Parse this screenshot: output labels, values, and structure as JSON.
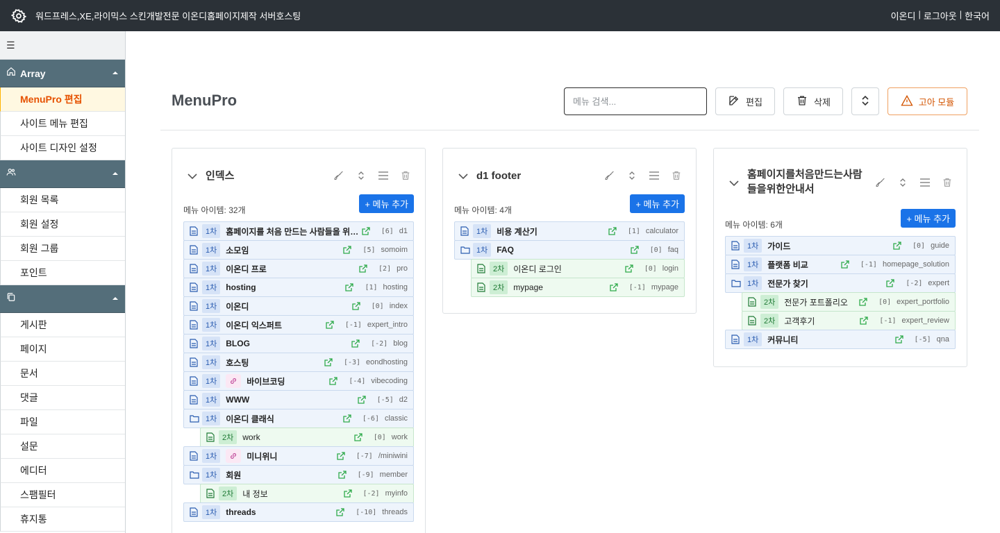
{
  "topbar": {
    "title": "워드프레스,XE,라이믹스 스킨개발전문 이온디홈페이지제작 서버호스팅",
    "user": "이온디",
    "logout": "로그아웃",
    "lang": "한국어",
    "sep": "|"
  },
  "sidebar": {
    "hamburger": "☰",
    "group1": {
      "title": "Array"
    },
    "items1": [
      "MenuPro 편집",
      "사이트 메뉴 편집",
      "사이트 디자인 설정"
    ],
    "items2": [
      "회원 목록",
      "회원 설정",
      "회원 그룹",
      "포인트"
    ],
    "items3": [
      "게시판",
      "페이지",
      "문서",
      "댓글",
      "파일",
      "설문",
      "에디터",
      "스팸필터",
      "휴지통"
    ]
  },
  "header": {
    "title": "MenuPro",
    "search_placeholder": "메뉴 검색...",
    "edit": "편집",
    "delete": "삭제",
    "orphan": "고아 모듈"
  },
  "panels": [
    {
      "title": "인덱스",
      "count": "메뉴 아이템: 32개",
      "add": "+ 메뉴 추가",
      "rows": [
        {
          "lvl": "1차",
          "name": "홈페이지를 처음 만드는 사람들을 위한…",
          "idx": "[6]",
          "slug": "d1",
          "child": false,
          "link": false
        },
        {
          "lvl": "1차",
          "name": "소모임",
          "idx": "[5]",
          "slug": "somoim",
          "child": false,
          "link": false
        },
        {
          "lvl": "1차",
          "name": "이온디 프로",
          "idx": "[2]",
          "slug": "pro",
          "child": false,
          "link": false
        },
        {
          "lvl": "1차",
          "name": "hosting",
          "idx": "[1]",
          "slug": "hosting",
          "child": false,
          "link": false
        },
        {
          "lvl": "1차",
          "name": "이온디",
          "idx": "[0]",
          "slug": "index",
          "child": false,
          "link": false
        },
        {
          "lvl": "1차",
          "name": "이온디 익스퍼트",
          "idx": "[-1]",
          "slug": "expert_intro",
          "child": false,
          "link": false
        },
        {
          "lvl": "1차",
          "name": "BLOG",
          "idx": "[-2]",
          "slug": "blog",
          "child": false,
          "link": false
        },
        {
          "lvl": "1차",
          "name": "호스팅",
          "idx": "[-3]",
          "slug": "eondhosting",
          "child": false,
          "link": false
        },
        {
          "lvl": "1차",
          "name": "바이브코딩",
          "idx": "[-4]",
          "slug": "vibecoding",
          "child": false,
          "link": true
        },
        {
          "lvl": "1차",
          "name": "WWW",
          "idx": "[-5]",
          "slug": "d2",
          "child": false,
          "link": false
        },
        {
          "lvl": "1차",
          "name": "이온디 클래식",
          "idx": "[-6]",
          "slug": "classic",
          "child": false,
          "link": false,
          "folder": true
        },
        {
          "lvl": "2차",
          "name": "work",
          "idx": "[0]",
          "slug": "work",
          "child": true,
          "link": false
        },
        {
          "lvl": "1차",
          "name": "미니위니",
          "idx": "[-7]",
          "slug": "/miniwini",
          "child": false,
          "link": true
        },
        {
          "lvl": "1차",
          "name": "회원",
          "idx": "[-9]",
          "slug": "member",
          "child": false,
          "link": false,
          "folder": true
        },
        {
          "lvl": "2차",
          "name": "내 정보",
          "idx": "[-2]",
          "slug": "myinfo",
          "child": true,
          "link": false
        },
        {
          "lvl": "1차",
          "name": "threads",
          "idx": "[-10]",
          "slug": "threads",
          "child": false,
          "link": false
        }
      ]
    },
    {
      "title": "d1 footer",
      "count": "메뉴 아이템: 4개",
      "add": "+ 메뉴 추가",
      "rows": [
        {
          "lvl": "1차",
          "name": "비용 계산기",
          "idx": "[1]",
          "slug": "calculator",
          "child": false,
          "link": false
        },
        {
          "lvl": "1차",
          "name": "FAQ",
          "idx": "[0]",
          "slug": "faq",
          "child": false,
          "link": false,
          "folder": true
        },
        {
          "lvl": "2차",
          "name": "이온디 로그인",
          "idx": "[0]",
          "slug": "login",
          "child": true,
          "link": false
        },
        {
          "lvl": "2차",
          "name": "mypage",
          "idx": "[-1]",
          "slug": "mypage",
          "child": true,
          "link": false
        }
      ]
    },
    {
      "title": "홈페이지를처음만드는사람들을위한안내서",
      "count": "메뉴 아이템: 6개",
      "add": "+ 메뉴 추가",
      "rows": [
        {
          "lvl": "1차",
          "name": "가이드",
          "idx": "[0]",
          "slug": "guide",
          "child": false,
          "link": false
        },
        {
          "lvl": "1차",
          "name": "플랫폼 비교",
          "idx": "[-1]",
          "slug": "homepage_solution",
          "child": false,
          "link": false
        },
        {
          "lvl": "1차",
          "name": "전문가 찾기",
          "idx": "[-2]",
          "slug": "expert",
          "child": false,
          "link": false,
          "folder": true
        },
        {
          "lvl": "2차",
          "name": "전문가 포트폴리오",
          "idx": "[0]",
          "slug": "expert_portfolio",
          "child": true,
          "link": false
        },
        {
          "lvl": "2차",
          "name": "고객후기",
          "idx": "[-1]",
          "slug": "expert_review",
          "child": true,
          "link": false
        },
        {
          "lvl": "1차",
          "name": "커뮤니티",
          "idx": "[-5]",
          "slug": "qna",
          "child": false,
          "link": false
        }
      ]
    }
  ]
}
